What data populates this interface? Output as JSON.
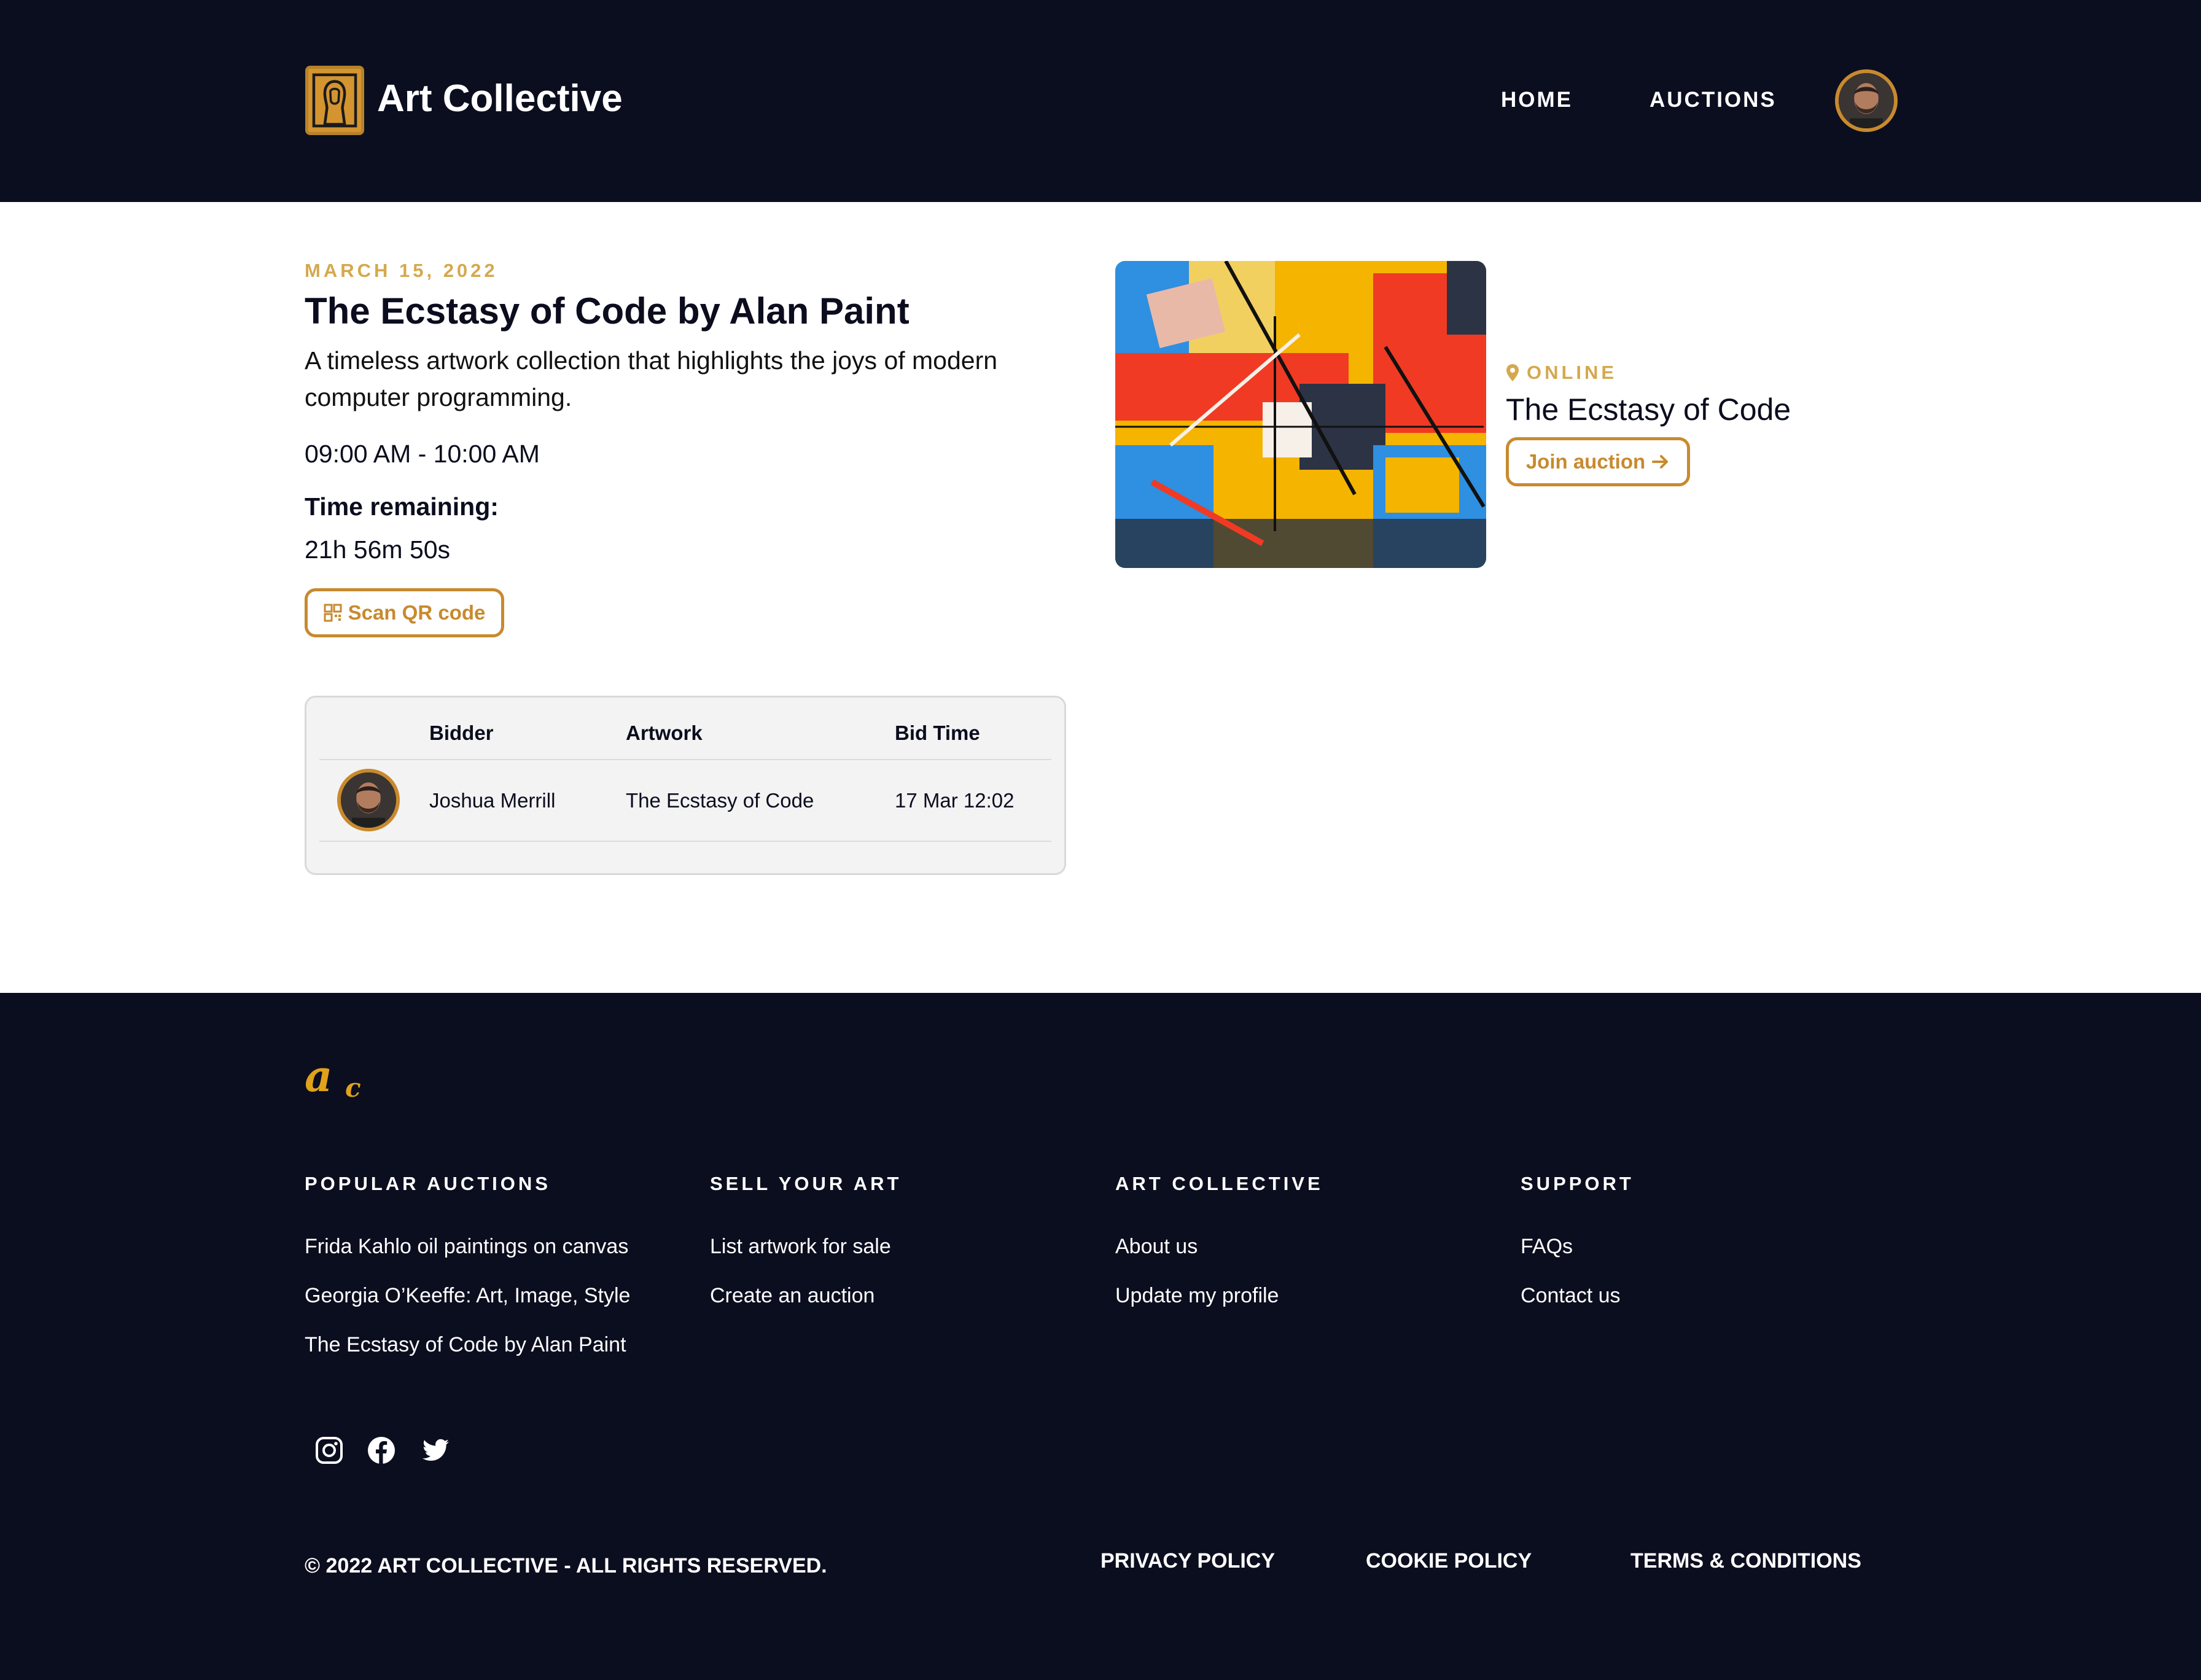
{
  "colors": {
    "dark_bg": "#0b0e1f",
    "accent_gold": "#c88a2e",
    "accent_light_gold": "#d4a94e",
    "table_bg": "#f3f3f3"
  },
  "header": {
    "brand": "Art Collective",
    "logo_icon": "framed-portrait-icon",
    "nav": [
      "HOME",
      "AUCTIONS"
    ]
  },
  "event": {
    "date": "MARCH 15, 2022",
    "title": "The Ecstasy of Code by Alan Paint",
    "description": "A timeless artwork collection that highlights the joys of modern computer programming.",
    "time_range": "09:00 AM - 10:00 AM",
    "time_remaining_label": "Time remaining:",
    "time_remaining_value": "21h 56m 50s",
    "scan_button": "Scan QR code"
  },
  "bids_table": {
    "headers": [
      "Bidder",
      "Artwork",
      "Bid Time"
    ],
    "rows": [
      {
        "bidder": "Joshua Merrill",
        "artwork": "The Ecstasy of Code",
        "bid_time": "17 Mar 12:02"
      }
    ]
  },
  "auction_card": {
    "location": "ONLINE",
    "title": "The Ecstasy of Code",
    "join_button": "Join auction"
  },
  "footer": {
    "columns": [
      {
        "heading": "POPULAR AUCTIONS",
        "links": [
          "Frida Kahlo oil paintings on canvas",
          "Georgia O’Keeffe: Art, Image, Style",
          "The Ecstasy of Code by Alan Paint"
        ]
      },
      {
        "heading": "SELL YOUR ART",
        "links": [
          "List artwork for sale",
          "Create an auction"
        ]
      },
      {
        "heading": "ART COLLECTIVE",
        "links": [
          "About us",
          "Update my profile"
        ]
      },
      {
        "heading": "SUPPORT",
        "links": [
          "FAQs",
          "Contact us"
        ]
      }
    ],
    "social": [
      "instagram-icon",
      "facebook-icon",
      "twitter-icon"
    ],
    "copyright": "© 2022 ART COLLECTIVE - ALL RIGHTS RESERVED.",
    "legal": [
      "PRIVACY POLICY",
      "COOKIE POLICY",
      "TERMS & CONDITIONS"
    ]
  }
}
